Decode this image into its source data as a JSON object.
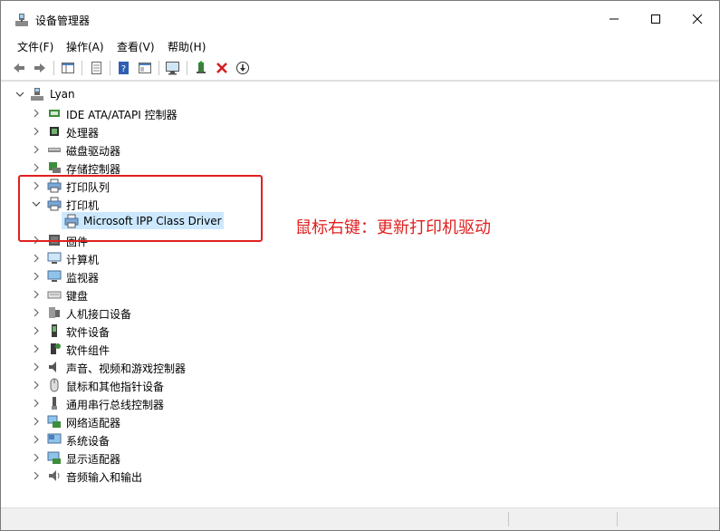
{
  "window": {
    "title": "设备管理器",
    "minimize_glyph": "—",
    "maximize_glyph": "☐",
    "close_glyph": "✕"
  },
  "menu": {
    "items": [
      "文件(F)",
      "操作(A)",
      "查看(V)",
      "帮助(H)"
    ]
  },
  "toolbar": {
    "buttons": [
      "back-arrow-icon",
      "forward-arrow-icon",
      "show-hide-tree-icon",
      "properties-icon",
      "help-icon",
      "view-icon",
      "monitor-scan-icon",
      "add-driver-icon",
      "uninstall-x-icon",
      "update-down-icon"
    ]
  },
  "tree": {
    "root": "Lyan",
    "categories": [
      {
        "label": "IDE ATA/ATAPI 控制器",
        "icon": "ide-controller-icon",
        "expanded": false
      },
      {
        "label": "处理器",
        "icon": "cpu-icon",
        "expanded": false
      },
      {
        "label": "磁盘驱动器",
        "icon": "disk-drive-icon",
        "expanded": false
      },
      {
        "label": "存储控制器",
        "icon": "storage-controller-icon",
        "expanded": false
      },
      {
        "label": "打印队列",
        "icon": "printer-icon",
        "expanded": false
      },
      {
        "label": "打印机",
        "icon": "printer-icon",
        "expanded": true
      },
      {
        "label": "固件",
        "icon": "firmware-icon",
        "expanded": false
      },
      {
        "label": "计算机",
        "icon": "computer-icon",
        "expanded": false
      },
      {
        "label": "监视器",
        "icon": "monitor-icon",
        "expanded": false
      },
      {
        "label": "键盘",
        "icon": "keyboard-icon",
        "expanded": false
      },
      {
        "label": "人机接口设备",
        "icon": "hid-icon",
        "expanded": false
      },
      {
        "label": "软件设备",
        "icon": "software-device-icon",
        "expanded": false
      },
      {
        "label": "软件组件",
        "icon": "software-component-icon",
        "expanded": false
      },
      {
        "label": "声音、视频和游戏控制器",
        "icon": "speaker-icon",
        "expanded": false
      },
      {
        "label": "鼠标和其他指针设备",
        "icon": "mouse-icon",
        "expanded": false
      },
      {
        "label": "通用串行总线控制器",
        "icon": "usb-icon",
        "expanded": false
      },
      {
        "label": "网络适配器",
        "icon": "network-adapter-icon",
        "expanded": false
      },
      {
        "label": "系统设备",
        "icon": "system-device-icon",
        "expanded": false
      },
      {
        "label": "显示适配器",
        "icon": "display-adapter-icon",
        "expanded": false
      },
      {
        "label": "音频输入和输出",
        "icon": "audio-io-icon",
        "expanded": false
      }
    ],
    "printer_child": "Microsoft IPP Class Driver"
  },
  "annotation": {
    "text": "鼠标右键：更新打印机驱动",
    "color": "#e02020"
  },
  "colors": {
    "selection": "#cce8ff",
    "highlight_border": "#e02020"
  }
}
